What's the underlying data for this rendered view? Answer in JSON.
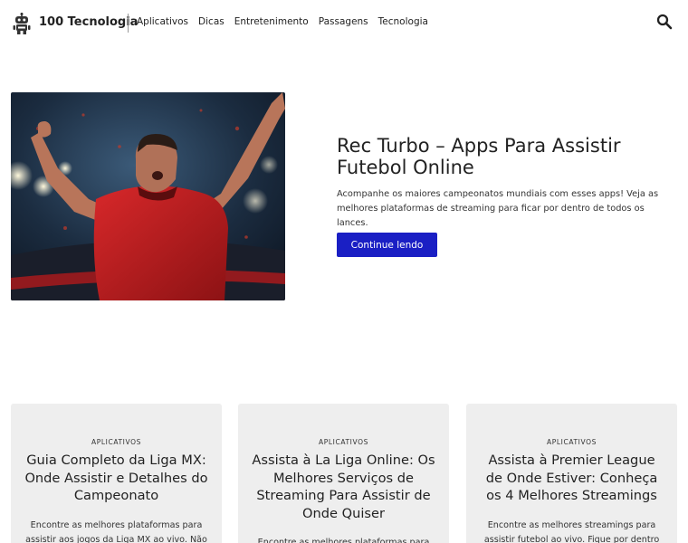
{
  "header": {
    "brand": "100 Tecnologia",
    "nav": [
      "Aplicativos",
      "Dicas",
      "Entretenimento",
      "Passagens",
      "Tecnologia"
    ]
  },
  "hero": {
    "title": "Rec Turbo – Apps Para Assistir Futebol Online",
    "excerpt": "Acompanhe os maiores campeonatos mundiais com esses apps! Veja as melhores plataformas de streaming para ficar por dentro de todos os lances.",
    "button": "Continue lendo"
  },
  "cards": [
    {
      "category": "APLICATIVOS",
      "title": "Guia Completo da Liga MX: Onde Assistir e Detalhes do Campeonato",
      "excerpt": "Encontre as melhores plataformas para assistir aos jogos da Liga MX ao vivo. Não perca nenhum lance do seu time"
    },
    {
      "category": "APLICATIVOS",
      "title": "Assista à La Liga Online: Os Melhores Serviços de Streaming Para Assistir de Onde Quiser",
      "excerpt": "Encontre as melhores plataformas para assistir aos jogos da La Liga ao vivo"
    },
    {
      "category": "APLICATIVOS",
      "title": "Assista à Premier League de Onde Estiver: Conheça os 4 Melhores Streamings",
      "excerpt": "Encontre as melhores streamings para assistir futebol ao vivo. Fique por dentro de todos os jogos e resultados da"
    }
  ],
  "colors": {
    "accent": "#1a1fc4",
    "card_bg": "#eeeeee"
  }
}
